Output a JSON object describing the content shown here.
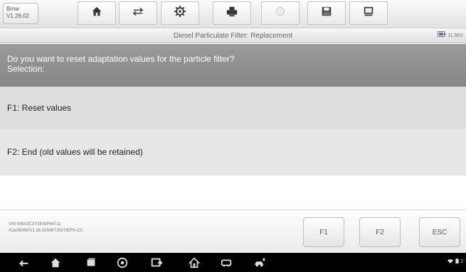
{
  "vehicle": {
    "make": "Bmw",
    "version": "V1.26.02"
  },
  "toolbar": {
    "items": [
      {
        "name": "home-icon"
      },
      {
        "name": "vehicle-swap-icon"
      },
      {
        "name": "settings-icon"
      },
      {
        "name": "print-icon"
      },
      {
        "name": "help-icon",
        "disabled": true
      },
      {
        "name": "save-icon"
      },
      {
        "name": "data-logging-icon"
      }
    ]
  },
  "title": "Diesel Particulate Filter: Replacement",
  "status": {
    "battery": "11.98V"
  },
  "question": {
    "line1": "Do you want to reset adaptation values for the particle filter?",
    "line2": "Selection:"
  },
  "options": [
    {
      "label": "F1: Reset values"
    },
    {
      "label": "F2: End (old values will be retained)"
    }
  ],
  "vehicle_info": {
    "vin": "VIN WBA3C3Y1EWP44711",
    "path": "/Car/BMW/V1.26.02/MKT/E87/EPS-CS"
  },
  "function_buttons": [
    "F1",
    "F2",
    "ESC"
  ],
  "nav": {
    "icons": [
      "back-icon",
      "home-icon",
      "recent-apps-icon",
      "chrome-icon",
      "screenshot-icon",
      "maxisys-home-icon",
      "vci-icon",
      "vehicle-connect-icon"
    ]
  },
  "system_status": {
    "time": "2:"
  },
  "colors": {
    "banner": "#8f8f8f",
    "option_row": "#dedede",
    "nav_bar": "#000000"
  }
}
